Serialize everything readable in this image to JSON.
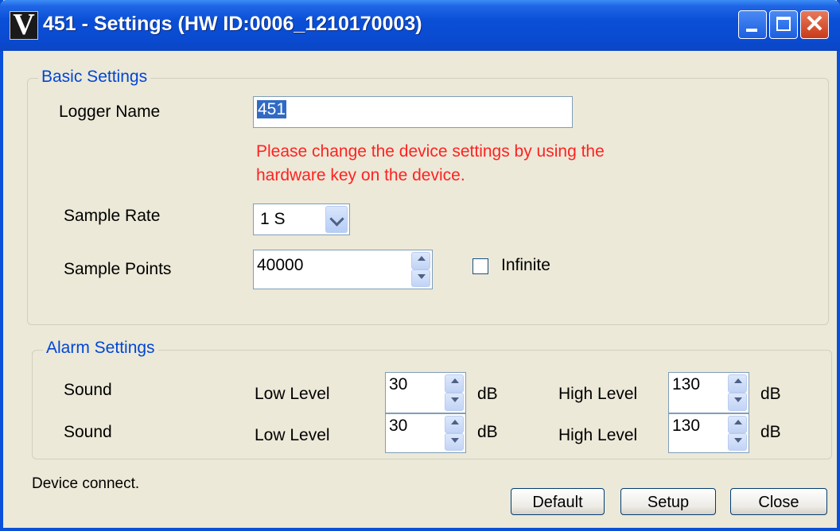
{
  "window": {
    "title": "451 - Settings (HW ID:0006_1210170003)",
    "app_icon_glyph": "V"
  },
  "basic": {
    "legend": "Basic Settings",
    "logger_name_label": "Logger Name",
    "logger_name_value": "451",
    "warning_line1": "Please change the device settings by using the",
    "warning_line2": "hardware key on the device.",
    "sample_rate_label": "Sample Rate",
    "sample_rate_value": "1 S",
    "sample_points_label": "Sample Points",
    "sample_points_value": "40000",
    "infinite_label": "Infinite",
    "infinite_checked": false
  },
  "alarm": {
    "legend": "Alarm Settings",
    "rows": [
      {
        "name": "Sound",
        "low_label": "Low Level",
        "low_value": "30",
        "low_unit": "dB",
        "high_label": "High Level",
        "high_value": "130",
        "high_unit": "dB"
      },
      {
        "name": "Sound",
        "low_label": "Low Level",
        "low_value": "30",
        "low_unit": "dB",
        "high_label": "High Level",
        "high_value": "130",
        "high_unit": "dB"
      }
    ]
  },
  "status_text": "Device connect.",
  "buttons": {
    "default": "Default",
    "setup": "Setup",
    "close": "Close"
  },
  "colors": {
    "title_bar": "#0a4fd6",
    "legend_text": "#0046d5",
    "warning_text": "#ff2222"
  }
}
